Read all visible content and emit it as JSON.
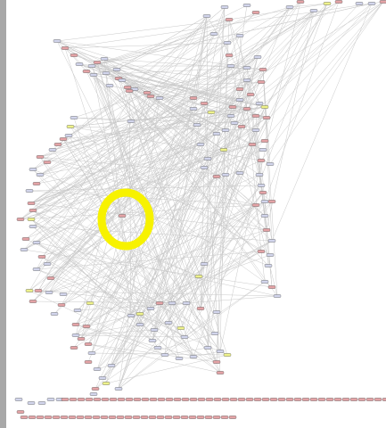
{
  "window": {
    "title": ""
  },
  "graph": {
    "node_colors": {
      "blue": "#d2d5ec",
      "red": "#e4a3a6",
      "yellow": "#eef28a"
    },
    "edge_color": "#c9c9c9",
    "highlight_color": "#f7f200",
    "highlight_note": "",
    "node_count_visible": ""
  }
}
